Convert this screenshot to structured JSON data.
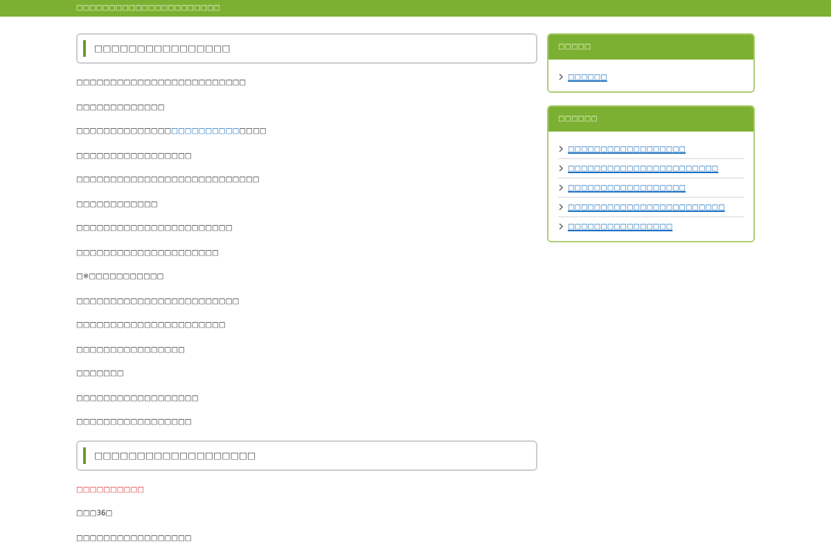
{
  "header": {
    "site_title": "□□□□□□□□□□□□□□□□□□□□□□"
  },
  "main": {
    "sections": [
      {
        "heading": "□□□□□□□□□□□□□□□□",
        "paragraphs": [
          {
            "kind": "text",
            "text": "□□□□□□□□□□□□□□□□□□□□□□□□□"
          },
          {
            "kind": "text",
            "text": "□□□□□□□□□□□□□"
          },
          {
            "kind": "link",
            "before": "□□□□□□□□□□□□□□",
            "link": "□□□□□□□□□□",
            "after": "□□□□"
          },
          {
            "kind": "text",
            "text": "□□□□□□□□□□□□□□□□□"
          },
          {
            "kind": "text",
            "text": "□□□□□□□□□□□□□□□□□□□□□□□□□□□"
          },
          {
            "kind": "text",
            "text": "□□□□□□□□□□□□"
          },
          {
            "kind": "text",
            "text": "□□□□□□□□□□□□□□□□□□□□□□□"
          },
          {
            "kind": "text",
            "text": "□□□□□□□□□□□□□□□□□□□□□"
          },
          {
            "kind": "text",
            "text": "□※□□□□□□□□□□□"
          },
          {
            "kind": "text",
            "text": "□□□□□□□□□□□□□□□□□□□□□□□□"
          },
          {
            "kind": "text",
            "text": "□□□□□□□□□□□□□□□□□□□□□□"
          },
          {
            "kind": "text",
            "text": "□□□□□□□□□□□□□□□□"
          },
          {
            "kind": "text",
            "text": "□□□□□□□"
          },
          {
            "kind": "text",
            "text": "□□□□□□□□□□□□□□□□□□"
          },
          {
            "kind": "text",
            "text": "□□□□□□□□□□□□□□□□□"
          }
        ]
      },
      {
        "heading": "□□□□□□□□□□□□□□□□□□□",
        "paragraphs": [
          {
            "kind": "alert",
            "text": "□□□□□□□□□□"
          },
          {
            "kind": "text",
            "text": "□□□36□"
          },
          {
            "kind": "text",
            "text": "□□□□□□□□□□□□□□□□□"
          }
        ]
      }
    ]
  },
  "sidebar": {
    "widgets": [
      {
        "title": "□□□□□",
        "links": [
          "□□□□□□"
        ]
      },
      {
        "title": "□□□□□□",
        "links": [
          "□□□□□□□□□□□□□□□□□□",
          "□□□□□□□□□□□□□□□□□□□□□□□",
          "□□□□□□□□□□□□□□□□□□",
          "□□□□□□□□□□□□□□□□□□□□□□□□",
          "□□□□□□□□□□□□□□□□"
        ]
      }
    ]
  }
}
